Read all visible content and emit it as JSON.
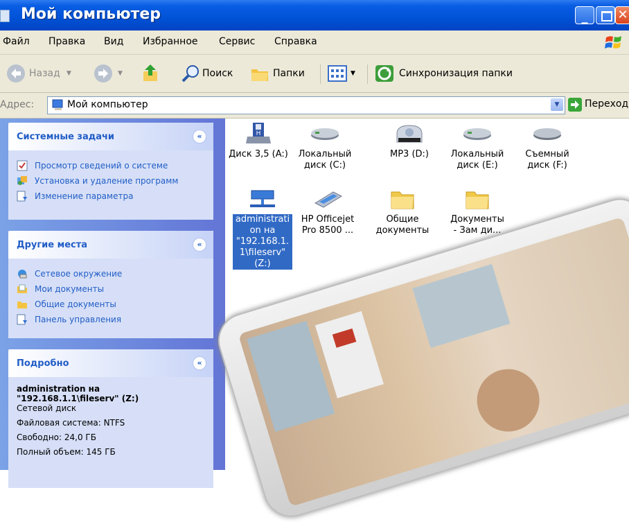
{
  "window": {
    "title": "Мой компьютер"
  },
  "menu": [
    "Файл",
    "Правка",
    "Вид",
    "Избранное",
    "Сервис",
    "Справка"
  ],
  "toolbar": {
    "back": "Назад",
    "search": "Поиск",
    "folders": "Папки",
    "sync": "Синхронизация папки"
  },
  "address": {
    "label": "Адрес:",
    "value": "Мой компьютер",
    "go": "Переход"
  },
  "system_tasks": {
    "title": "Системные задачи",
    "items": [
      "Просмотр сведений о системе",
      "Установка и удаление программ",
      "Изменение параметра"
    ]
  },
  "other_places": {
    "title": "Другие места",
    "items": [
      "Сетевое окружение",
      "Мои документы",
      "Общие документы",
      "Панель управления"
    ]
  },
  "details": {
    "title": "Подробно",
    "name": "administration на \"192.168.1.1\\fileserv\" (Z:)",
    "type": "Сетевой диск",
    "fs": "Файловая система: NTFS",
    "free": "Свободно: 24,0 ГБ",
    "total": "Полный объем: 145 ГБ"
  },
  "items": [
    {
      "label": "Диск 3,5 (A:)",
      "icon": "floppy-drive-icon"
    },
    {
      "label": "Локальный диск (C:)",
      "icon": "hard-drive-icon"
    },
    {
      "label": "MP3 (D:)",
      "icon": "cdrom-icon",
      "badge": "CDROM"
    },
    {
      "label": "Локальный диск (E:)",
      "icon": "hard-drive-icon"
    },
    {
      "label": "Съемный диск (F:)",
      "icon": "removable-drive-icon"
    },
    {
      "label": "administrati on на \"192.168.1. 1\\fileserv\" (Z:)",
      "icon": "network-drive-icon"
    },
    {
      "label": "HP Officejet Pro 8500 ...",
      "icon": "scanner-icon"
    },
    {
      "label": "Общие документы",
      "icon": "folder-icon"
    },
    {
      "label": "Документы - Зам ди...",
      "icon": "folder-icon"
    }
  ]
}
